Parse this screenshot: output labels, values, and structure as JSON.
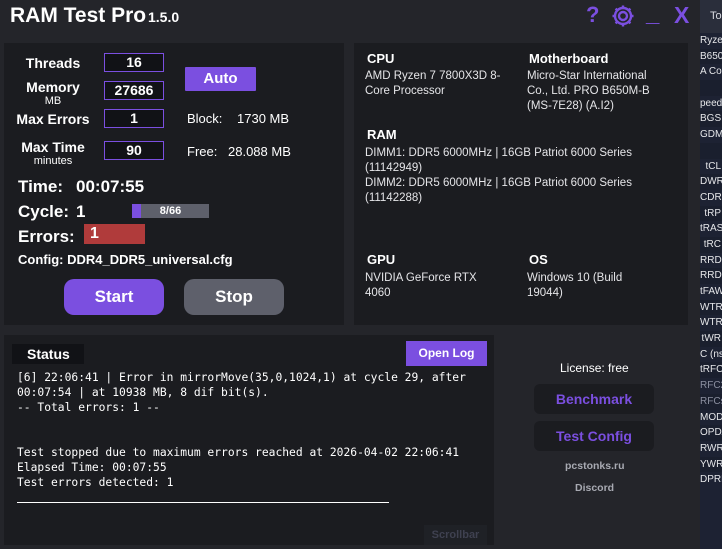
{
  "titlebar": {
    "app_name": "RAM Test Pro",
    "version": "1.5.0",
    "help": "?",
    "minimize": "_",
    "close": "X"
  },
  "settings": {
    "threads_label": "Threads",
    "threads_value": "16",
    "memory_label": "Memory",
    "memory_unit": "MB",
    "memory_value": "27686",
    "max_errors_label": "Max Errors",
    "max_errors_value": "1",
    "max_time_label": "Max Time",
    "max_time_unit": "minutes",
    "max_time_value": "90",
    "auto_button": "Auto",
    "block_label": "Block:",
    "block_value": "1730 MB",
    "free_label": "Free:",
    "free_value": "28.088 MB"
  },
  "run": {
    "time_label": "Time:",
    "time_value": "00:07:55",
    "cycle_label": "Cycle:",
    "cycle_value": "1",
    "cycle_progress_text": "8/66",
    "cycle_progress_fraction": 0.121,
    "errors_label": "Errors:",
    "errors_value": "1",
    "config_text": "Config: DDR4_DDR5_universal.cfg",
    "start_button": "Start",
    "stop_button": "Stop"
  },
  "system": {
    "cpu_label": "CPU",
    "cpu_line1": "AMD Ryzen 7 7800X3D 8-",
    "cpu_line2": "Core Processor",
    "mb_label": "Motherboard",
    "mb_line1": "Micro-Star International",
    "mb_line2": "Co., Ltd. PRO B650M-B",
    "mb_line3": "(MS-7E28) (A.I2)",
    "ram_label": "RAM",
    "ram_line1": "DIMM1: DDR5 6000MHz | 16GB Patriot 6000 Series",
    "ram_line2": "(11142949)",
    "ram_line3": "DIMM2: DDR5 6000MHz | 16GB Patriot 6000 Series",
    "ram_line4": "(11142288)",
    "gpu_label": "GPU",
    "gpu_line1": "NVIDIA GeForce RTX",
    "gpu_line2": "4060",
    "os_label": "OS",
    "os_line1": "Windows 10 (Build",
    "os_line2": "19044)"
  },
  "status": {
    "title": "Status",
    "open_log_button": "Open Log",
    "log_text": "[6] 22:06:41 | Error in mirrorMove(35,0,1024,1) at cycle 29, after\n00:07:54 | at 10938 MB, 8 dif bit(s).\n-- Total errors: 1 --\n\n\nTest stopped due to maximum errors reached at 2026-04-02 22:06:41\nElapsed Time: 00:07:55\nTest errors detected: 1",
    "scrollbar_label": "Scrollbar"
  },
  "side": {
    "license": "License: free",
    "benchmark_button": "Benchmark",
    "test_config_button": "Test Config",
    "site": "pcstonks.ru",
    "discord": "Discord"
  },
  "background_window": {
    "tab": "To",
    "lines": [
      "Ryze",
      "B650",
      "A Co",
      "",
      "peed",
      "BGS",
      "GDM",
      "",
      "tCL",
      "DWR",
      "CDRD",
      "tRP",
      "tRAS",
      "tRC",
      "RRDS",
      "RRDL",
      "tFAW",
      "WTRS",
      "WTRL",
      "tWR",
      "C (ns)",
      "tRFC",
      "RFC2",
      "RFCsb",
      "MOD",
      "OPDA",
      "RWR",
      "YWRL",
      "DPREE"
    ]
  },
  "colors": {
    "accent": "#7b4fe0",
    "error": "#b03b3b",
    "panel": "#1b1c20",
    "background": "#24252a"
  }
}
